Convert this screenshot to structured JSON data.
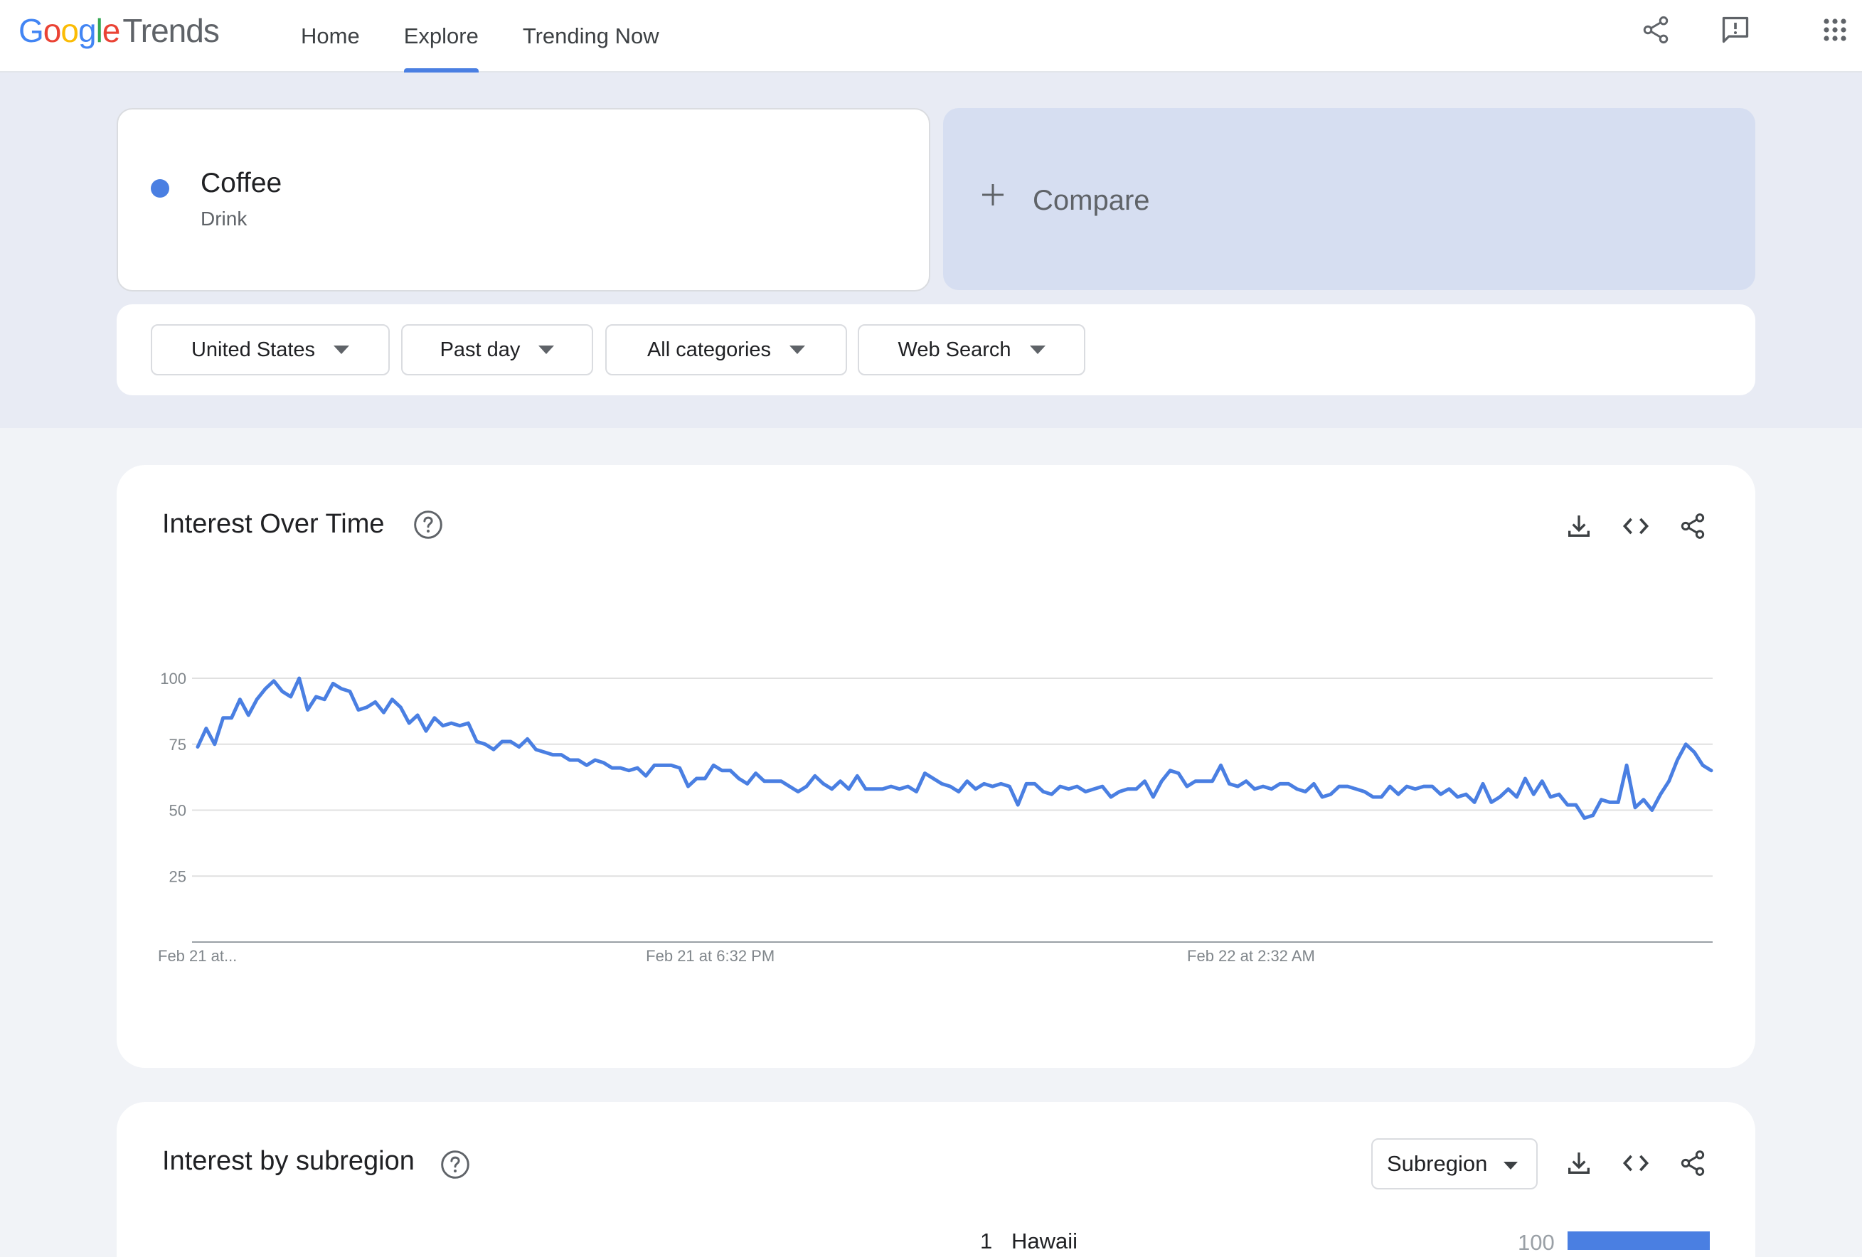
{
  "app": {
    "logo_google": [
      "G",
      "o",
      "o",
      "g",
      "l",
      "e"
    ],
    "logo_trends": "Trends"
  },
  "nav": {
    "items": [
      {
        "label": "Home",
        "active": false
      },
      {
        "label": "Explore",
        "active": true
      },
      {
        "label": "Trending Now",
        "active": false
      }
    ]
  },
  "header_icons": [
    "share-icon",
    "feedback-icon",
    "apps-grid-icon"
  ],
  "search": {
    "term": {
      "name": "Coffee",
      "type": "Drink",
      "color": "#4a7fe2"
    },
    "compare_label": "Compare"
  },
  "filters": [
    {
      "label": "United States"
    },
    {
      "label": "Past day"
    },
    {
      "label": "All categories"
    },
    {
      "label": "Web Search"
    }
  ],
  "interest_over_time": {
    "title": "Interest Over Time",
    "actions": [
      "download-icon",
      "embed-code-icon",
      "share-icon"
    ],
    "chart_data": {
      "type": "line",
      "x_tick_labels": [
        "Feb 21 at...",
        "Feb 21 at 6:32 PM",
        "Feb 22 at 2:32 AM"
      ],
      "x_tick_index": [
        0,
        61,
        125
      ],
      "ylim": [
        0,
        100
      ],
      "y_ticks": [
        100,
        75,
        50,
        25
      ],
      "grid": true,
      "series": [
        {
          "color": "#4a7fe2",
          "values": [
            74,
            81,
            75,
            85,
            85,
            92,
            86,
            92,
            96,
            99,
            95,
            93,
            100,
            88,
            93,
            92,
            98,
            96,
            95,
            88,
            89,
            91,
            87,
            92,
            89,
            83,
            86,
            80,
            85,
            82,
            83,
            82,
            83,
            76,
            75,
            73,
            76,
            76,
            74,
            77,
            73,
            72,
            71,
            71,
            69,
            69,
            67,
            69,
            68,
            66,
            66,
            65,
            66,
            63,
            67,
            67,
            67,
            66,
            59,
            62,
            62,
            67,
            65,
            65,
            62,
            60,
            64,
            61,
            61,
            61,
            59,
            57,
            59,
            63,
            60,
            58,
            61,
            58,
            63,
            58,
            58,
            58,
            59,
            58,
            59,
            57,
            64,
            62,
            60,
            59,
            57,
            61,
            58,
            60,
            59,
            60,
            59,
            52,
            60,
            60,
            57,
            56,
            59,
            58,
            59,
            57,
            58,
            59,
            55,
            57,
            58,
            58,
            61,
            55,
            61,
            65,
            64,
            59,
            61,
            61,
            61,
            67,
            60,
            59,
            61,
            58,
            59,
            58,
            60,
            60,
            58,
            57,
            60,
            55,
            56,
            59,
            59,
            58,
            57,
            55,
            55,
            59,
            56,
            59,
            58,
            59,
            59,
            56,
            58,
            55,
            56,
            53,
            60,
            53,
            55,
            58,
            55,
            62,
            56,
            61,
            55,
            56,
            52,
            52,
            47,
            48,
            54,
            53,
            53,
            67,
            51,
            54,
            50,
            56,
            61,
            69,
            75,
            72,
            67,
            65
          ]
        }
      ]
    }
  },
  "interest_by_subregion": {
    "title": "Interest by subregion",
    "select_label": "Subregion",
    "actions": [
      "download-icon",
      "embed-code-icon",
      "share-icon"
    ],
    "rows": [
      {
        "rank": "1",
        "name": "Hawaii",
        "value": 100
      }
    ]
  }
}
